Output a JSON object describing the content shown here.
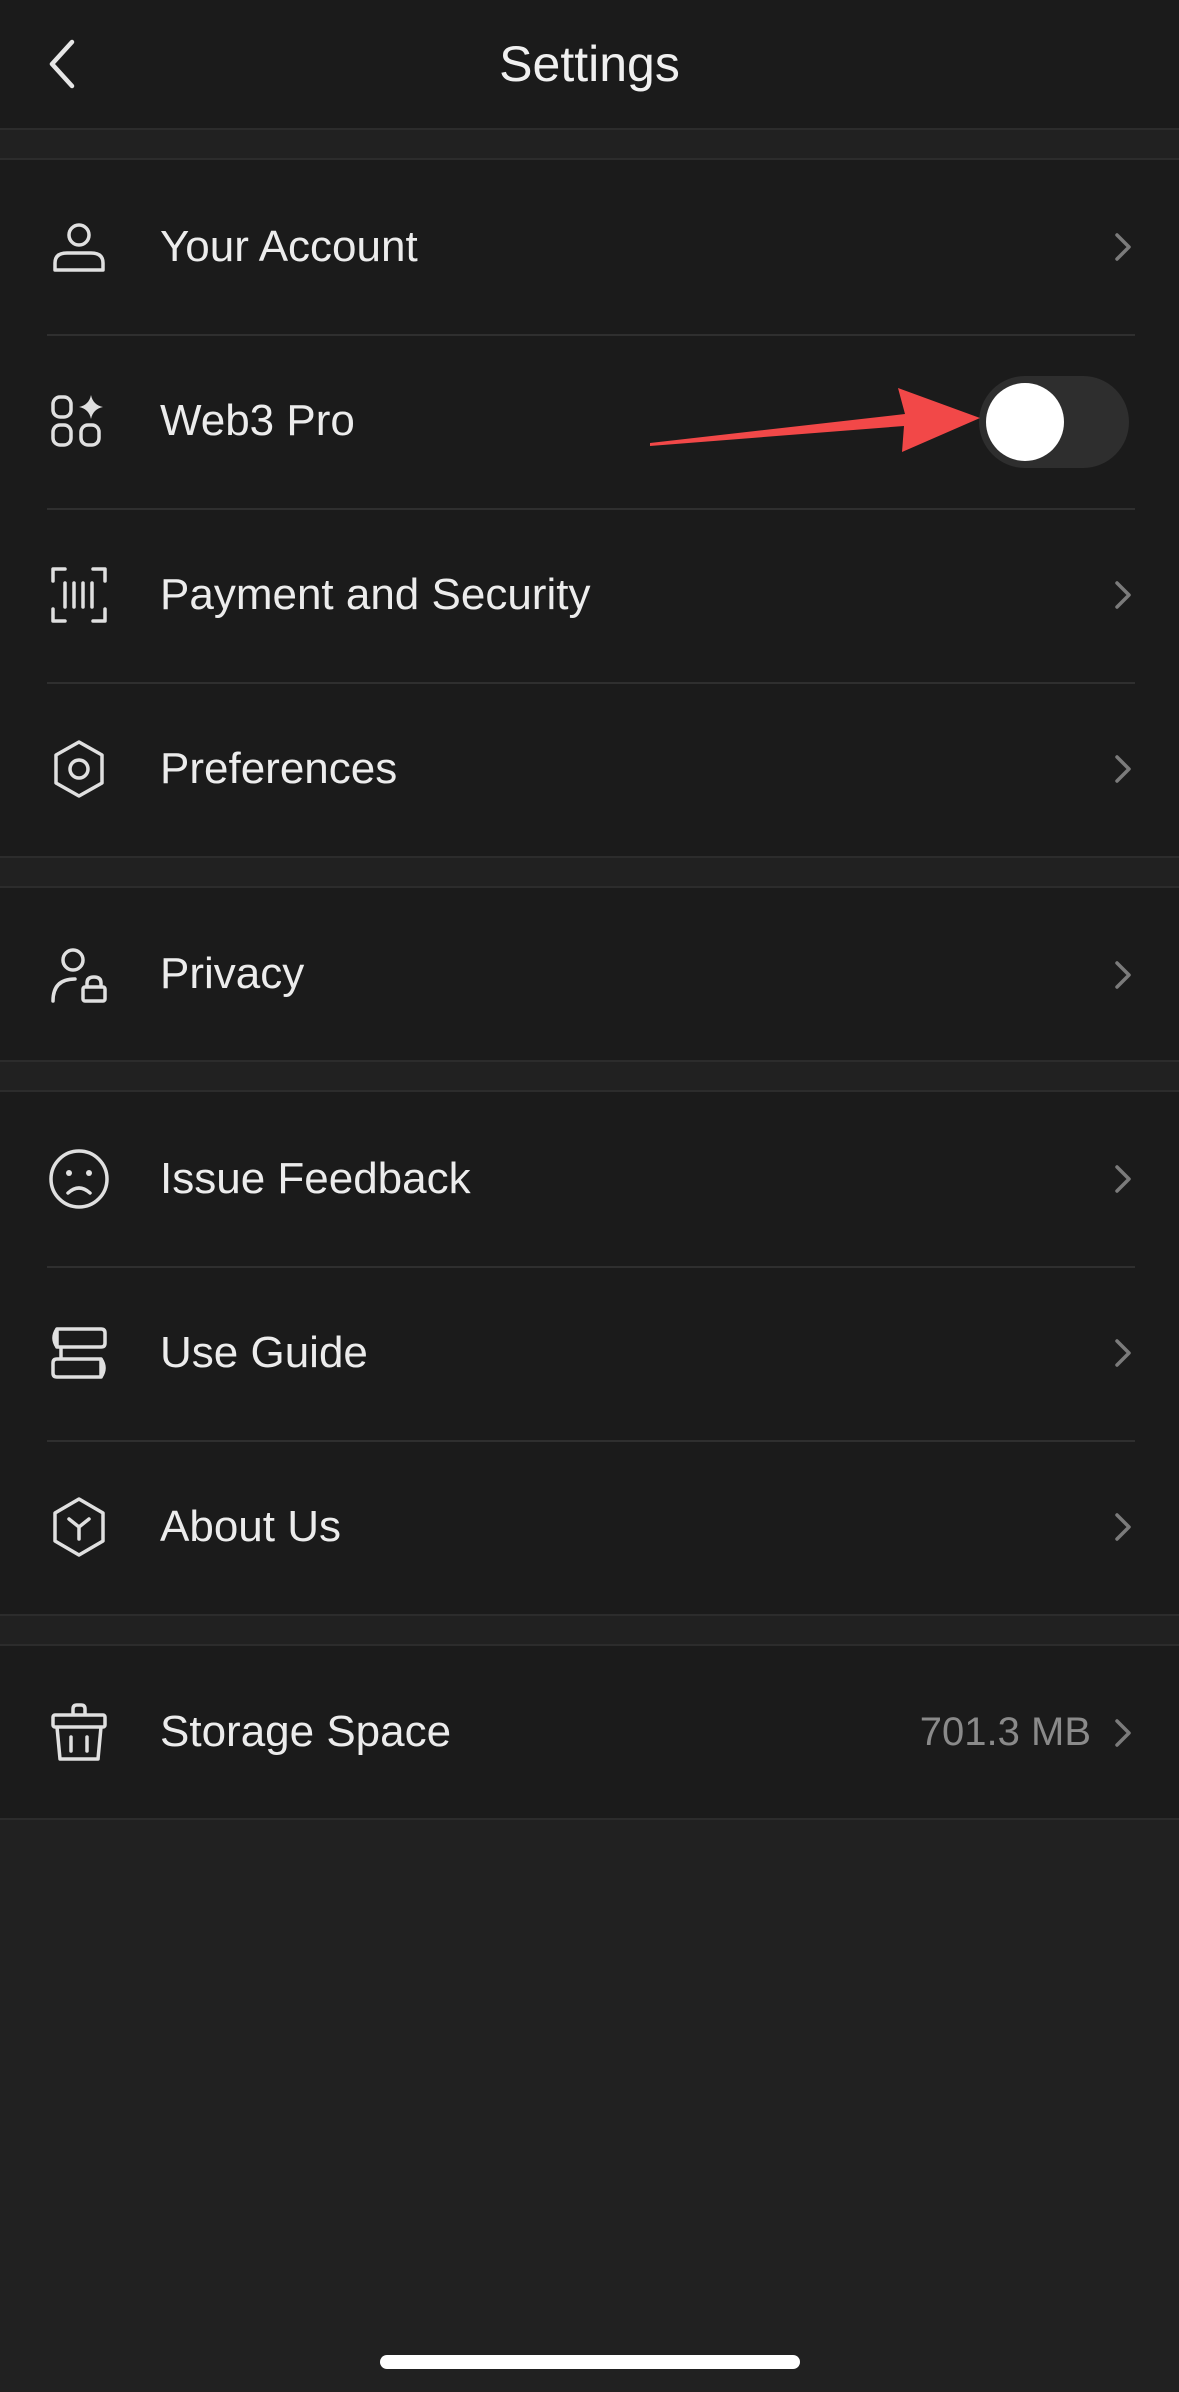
{
  "header": {
    "title": "Settings",
    "back_icon": "chevron-left-icon"
  },
  "sections": [
    {
      "items": [
        {
          "label": "Your Account",
          "icon": "user-icon",
          "control": "chevron"
        },
        {
          "label": "Web3 Pro",
          "icon": "apps-sparkle-icon",
          "control": "toggle",
          "toggle_on": false
        },
        {
          "label": "Payment and Security",
          "icon": "scan-barcode-icon",
          "control": "chevron"
        },
        {
          "label": "Preferences",
          "icon": "gear-icon",
          "control": "chevron"
        }
      ]
    },
    {
      "items": [
        {
          "label": "Privacy",
          "icon": "user-lock-icon",
          "control": "chevron"
        }
      ]
    },
    {
      "items": [
        {
          "label": "Issue Feedback",
          "icon": "sad-face-icon",
          "control": "chevron"
        },
        {
          "label": "Use Guide",
          "icon": "book-stack-icon",
          "control": "chevron"
        },
        {
          "label": "About Us",
          "icon": "hexagon-logo-icon",
          "control": "chevron"
        }
      ]
    },
    {
      "items": [
        {
          "label": "Storage Space",
          "icon": "basket-icon",
          "control": "chevron",
          "value": "701.3 MB"
        }
      ]
    }
  ],
  "annotation": {
    "type": "arrow",
    "color": "#f24848"
  },
  "colors": {
    "background": "#212121",
    "section_background": "#1b1b1b",
    "text": "#ececec",
    "secondary_text": "#8a8a8a"
  }
}
